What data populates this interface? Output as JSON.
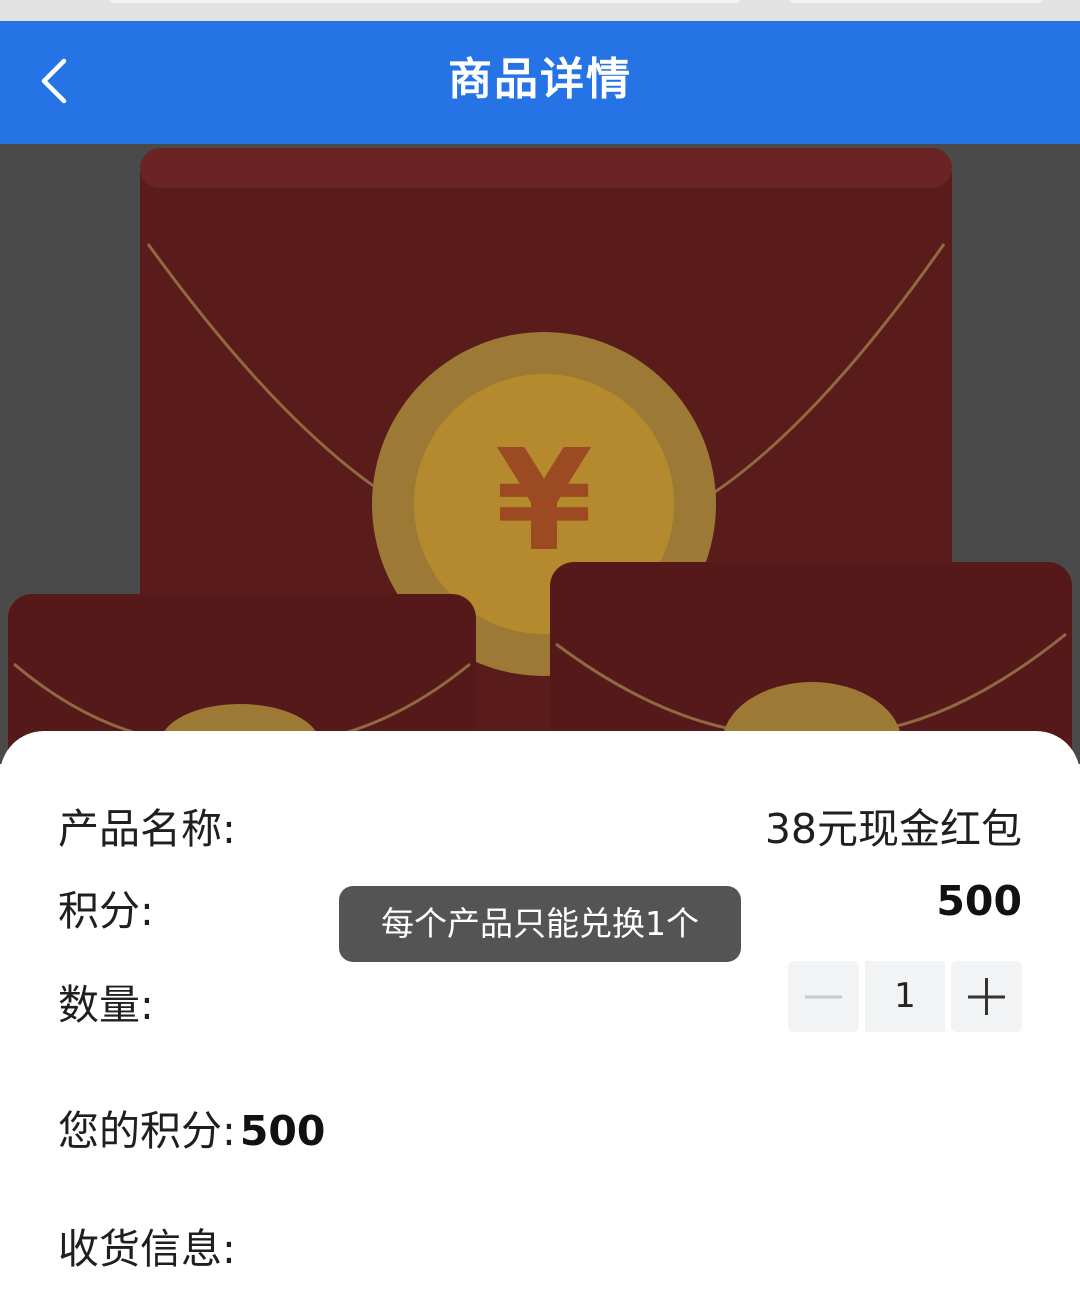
{
  "header": {
    "title": "商品详情"
  },
  "product": {
    "name_label": "产品名称:",
    "name_value": "38元现金红包",
    "points_label": "积分:",
    "points_value": "500",
    "quantity_label": "数量:",
    "quantity_value": "1",
    "my_points_label": "您的积分:",
    "my_points_value": "500",
    "shipping_label": "收货信息:"
  },
  "toast": {
    "text": "每个产品只能兑换1个"
  },
  "icons": {
    "back": "chevron-left-icon",
    "minus": "minus-icon",
    "plus": "plus-icon"
  },
  "colors": {
    "accent": "#2673e6",
    "envelope": "#5a1a1a",
    "coin": "#b58a2e"
  }
}
